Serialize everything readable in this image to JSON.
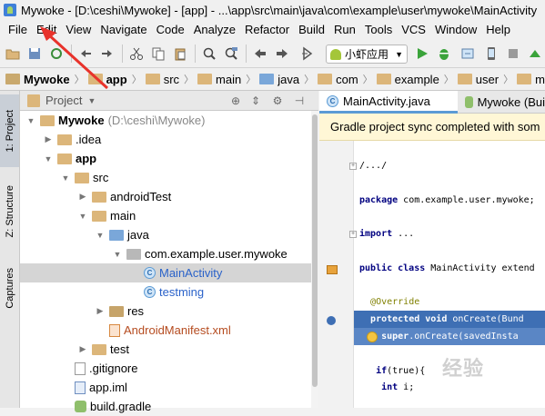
{
  "window": {
    "title": "Mywoke - [D:\\ceshi\\Mywoke] - [app] - ...\\app\\src\\main\\java\\com\\example\\user\\mywoke\\MainActivity"
  },
  "menu": {
    "items": [
      "File",
      "Edit",
      "View",
      "Navigate",
      "Code",
      "Analyze",
      "Refactor",
      "Build",
      "Run",
      "Tools",
      "VCS",
      "Window",
      "Help"
    ]
  },
  "toolbar": {
    "run_config": "小虾应用"
  },
  "breadcrumbs": [
    {
      "label": "Mywoke",
      "kind": "project"
    },
    {
      "label": "app",
      "kind": "module"
    },
    {
      "label": "src",
      "kind": "folder"
    },
    {
      "label": "main",
      "kind": "folder"
    },
    {
      "label": "java",
      "kind": "source"
    },
    {
      "label": "com",
      "kind": "folder"
    },
    {
      "label": "example",
      "kind": "folder"
    },
    {
      "label": "user",
      "kind": "folder"
    },
    {
      "label": "mywoke",
      "kind": "folder"
    }
  ],
  "left_stripe": {
    "tabs": [
      "1: Project",
      "Z: Structure",
      "Captures"
    ]
  },
  "project_panel": {
    "header_label": "Project",
    "tree": [
      {
        "label": "Mywoke",
        "suffix": "(D:\\ceshi\\Mywoke)",
        "indent": 0,
        "arrow": "▼",
        "icon": "folder",
        "style": "bold"
      },
      {
        "label": ".idea",
        "indent": 1,
        "arrow": "▶",
        "icon": "folder",
        "style": ""
      },
      {
        "label": "app",
        "indent": 1,
        "arrow": "▼",
        "icon": "folder",
        "style": "bold"
      },
      {
        "label": "src",
        "indent": 2,
        "arrow": "▼",
        "icon": "folder",
        "style": ""
      },
      {
        "label": "androidTest",
        "indent": 3,
        "arrow": "▶",
        "icon": "folder",
        "style": ""
      },
      {
        "label": "main",
        "indent": 3,
        "arrow": "▼",
        "icon": "folder",
        "style": ""
      },
      {
        "label": "java",
        "indent": 4,
        "arrow": "▼",
        "icon": "folder-blue",
        "style": ""
      },
      {
        "label": "com.example.user.mywoke",
        "indent": 5,
        "arrow": "▼",
        "icon": "package",
        "style": ""
      },
      {
        "label": "MainActivity",
        "indent": 6,
        "arrow": "",
        "icon": "class",
        "style": "blue",
        "selected": true
      },
      {
        "label": "testming",
        "indent": 6,
        "arrow": "",
        "icon": "class",
        "style": "blue"
      },
      {
        "label": "res",
        "indent": 4,
        "arrow": "▶",
        "icon": "folder-res",
        "style": ""
      },
      {
        "label": "AndroidManifest.xml",
        "indent": 4,
        "arrow": "",
        "icon": "xml",
        "style": "red"
      },
      {
        "label": "test",
        "indent": 3,
        "arrow": "▶",
        "icon": "folder",
        "style": ""
      },
      {
        "label": ".gitignore",
        "indent": 2,
        "arrow": "",
        "icon": "file",
        "style": ""
      },
      {
        "label": "app.iml",
        "indent": 2,
        "arrow": "",
        "icon": "iml",
        "style": ""
      },
      {
        "label": "build.gradle",
        "indent": 2,
        "arrow": "",
        "icon": "gradle",
        "style": ""
      }
    ]
  },
  "editor": {
    "tabs": [
      {
        "label": "MainActivity.java",
        "active": true,
        "icon": "class"
      },
      {
        "label": "Mywoke (Bui",
        "active": false,
        "icon": "gradle"
      }
    ],
    "notification": "Gradle project sync completed with som",
    "code_lines": [
      {
        "text": "/.../",
        "style": "fold"
      },
      {
        "text": "",
        "style": ""
      },
      {
        "kw": "package",
        "text": " com.example.user.mywoke;",
        "style": ""
      },
      {
        "text": "",
        "style": ""
      },
      {
        "kw": "import",
        "text": " ...",
        "style": "fold"
      },
      {
        "text": "",
        "style": ""
      },
      {
        "kw": "public class",
        "text": " MainActivity extend",
        "style": ""
      },
      {
        "text": "",
        "style": ""
      },
      {
        "ann": "@Override",
        "text": "",
        "style": ""
      },
      {
        "kw": "protected void",
        "text": " onCreate(Bund",
        "style": "hl"
      },
      {
        "kw": "super",
        "text": ".onCreate(savedInsta",
        "style": "hl2"
      },
      {
        "text": "",
        "style": ""
      },
      {
        "kw": "if",
        "text": "(true){",
        "style": ""
      },
      {
        "kw": "int",
        "text": " i;",
        "style": ""
      }
    ]
  },
  "watermark": "经验"
}
